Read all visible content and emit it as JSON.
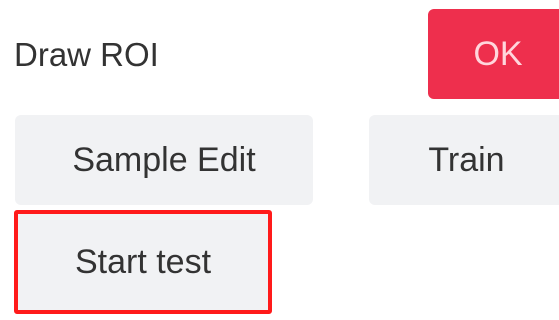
{
  "panel": {
    "draw_roi_label": "Draw ROI",
    "ok_label": "OK",
    "sample_edit_label": "Sample Edit",
    "train_label": "Train",
    "start_test_label": "Start test"
  },
  "colors": {
    "ok_background": "#ee2f4d",
    "ok_text": "#ffd6dc",
    "button_background": "#f1f2f4",
    "highlight_border": "#ff1a1a",
    "text": "#333333"
  }
}
